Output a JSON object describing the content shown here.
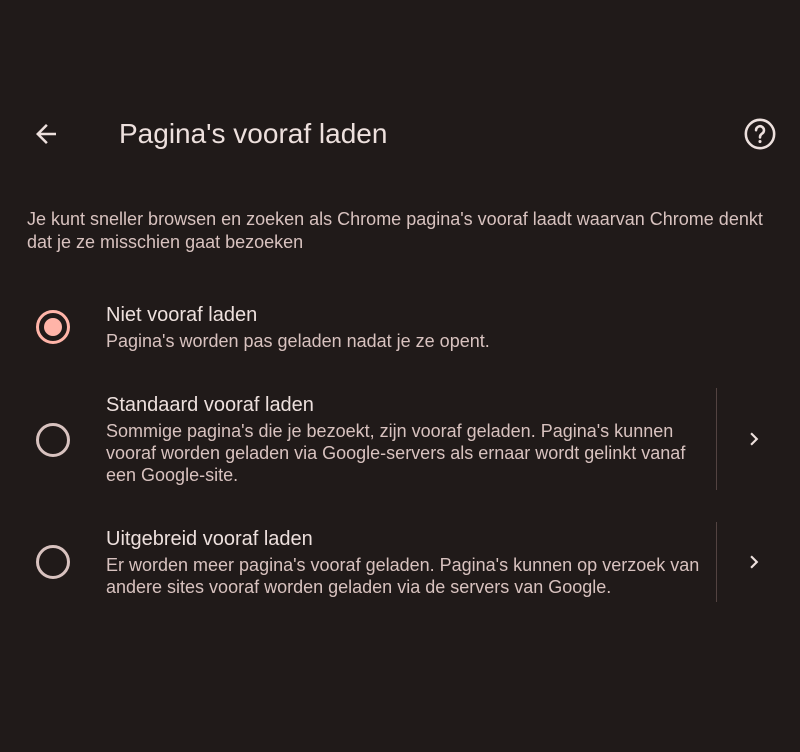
{
  "header": {
    "title": "Pagina's vooraf laden",
    "back_icon": "arrow-back-icon",
    "help_icon": "help-circle-icon"
  },
  "description": "Je kunt sneller browsen en zoeken als Chrome pagina's vooraf laadt waarvan Chrome denkt dat je ze misschien gaat bezoeken",
  "options": [
    {
      "title": "Niet vooraf laden",
      "subtitle": "Pagina's worden pas geladen nadat je ze opent.",
      "selected": true
    },
    {
      "title": "Standaard vooraf laden",
      "subtitle": "Sommige pagina's die je bezoekt, zijn vooraf geladen. Pagina's kunnen vooraf worden geladen via Google-servers als ernaar wordt gelinkt vanaf een Google-site.",
      "selected": false,
      "has_details": true
    },
    {
      "title": "Uitgebreid vooraf laden",
      "subtitle": "Er worden meer pagina's vooraf geladen. Pagina's kunnen op verzoek van andere sites vooraf worden geladen via de servers van Google.",
      "selected": false,
      "has_details": true
    }
  ],
  "colors": {
    "background": "#201a19",
    "accent": "#ffb4a8",
    "text_primary": "#ede0dd",
    "text_secondary": "#d8c2bf",
    "divider": "#534341"
  }
}
